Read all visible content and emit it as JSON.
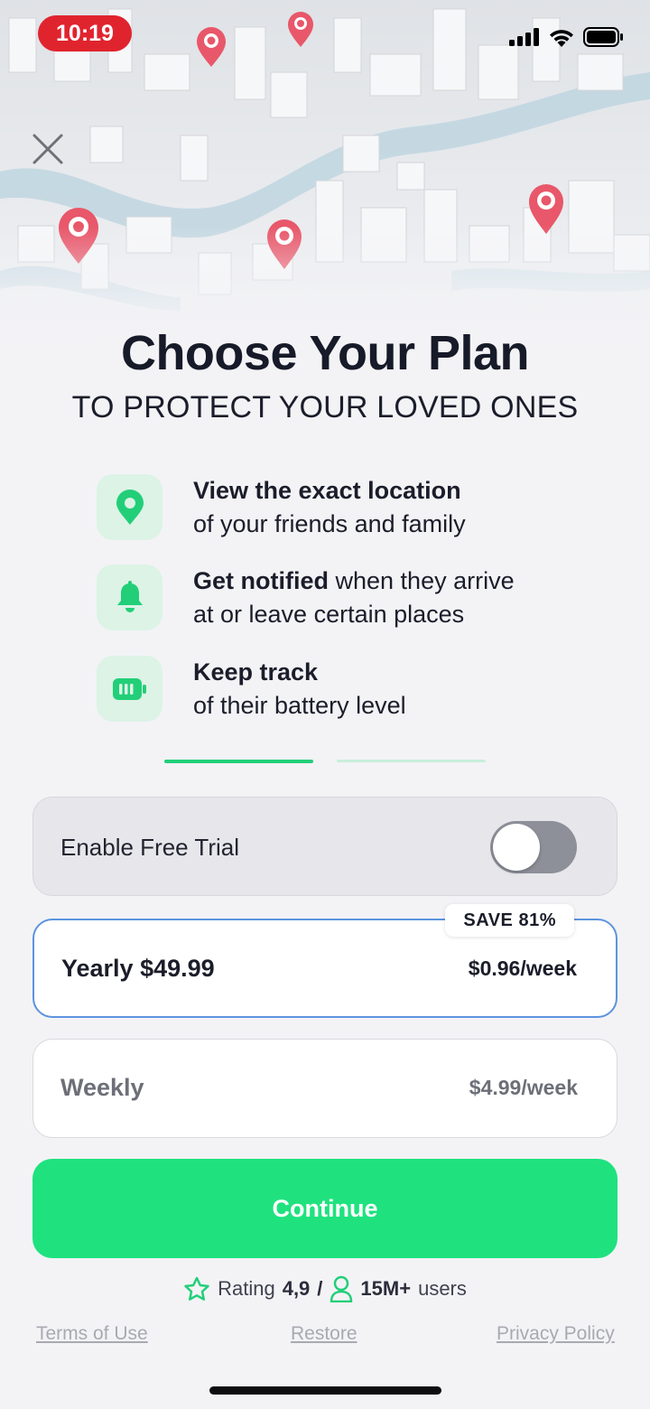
{
  "status_bar": {
    "time": "10:19",
    "signal_icon": "cellular-signal-icon",
    "wifi_icon": "wifi-icon",
    "battery_icon": "battery-icon"
  },
  "close_icon": "close-icon",
  "heading": {
    "title": "Choose Your Plan",
    "subtitle": "TO PROTECT YOUR LOVED ONES"
  },
  "features": [
    {
      "icon": "location-pin-icon",
      "bold": "View the exact location",
      "rest_inline": "",
      "line2": "of your friends and family"
    },
    {
      "icon": "bell-icon",
      "bold": "Get notified",
      "rest_inline": " when they arrive",
      "line2": "at or leave certain places"
    },
    {
      "icon": "battery-level-icon",
      "bold": "Keep track",
      "rest_inline": "",
      "line2": "of their battery level"
    }
  ],
  "trial": {
    "label": "Enable Free Trial",
    "enabled": false
  },
  "plans": [
    {
      "name": "Yearly $49.99",
      "price_per_week": "$0.96/week",
      "badge": "SAVE 81%",
      "selected": true
    },
    {
      "name": "Weekly",
      "price_per_week": "$4.99/week",
      "selected": false
    }
  ],
  "continue_label": "Continue",
  "rating": {
    "prefix": "Rating",
    "value": "4,9",
    "separator": "/",
    "users": "15M+",
    "users_suffix": "users"
  },
  "footer": {
    "terms": "Terms of Use",
    "restore": "Restore",
    "privacy": "Privacy Policy"
  },
  "colors": {
    "accent": "#1fe27f",
    "selected_border": "#5c93df",
    "pin": "#e8576a",
    "time_pill": "#e0242e"
  }
}
